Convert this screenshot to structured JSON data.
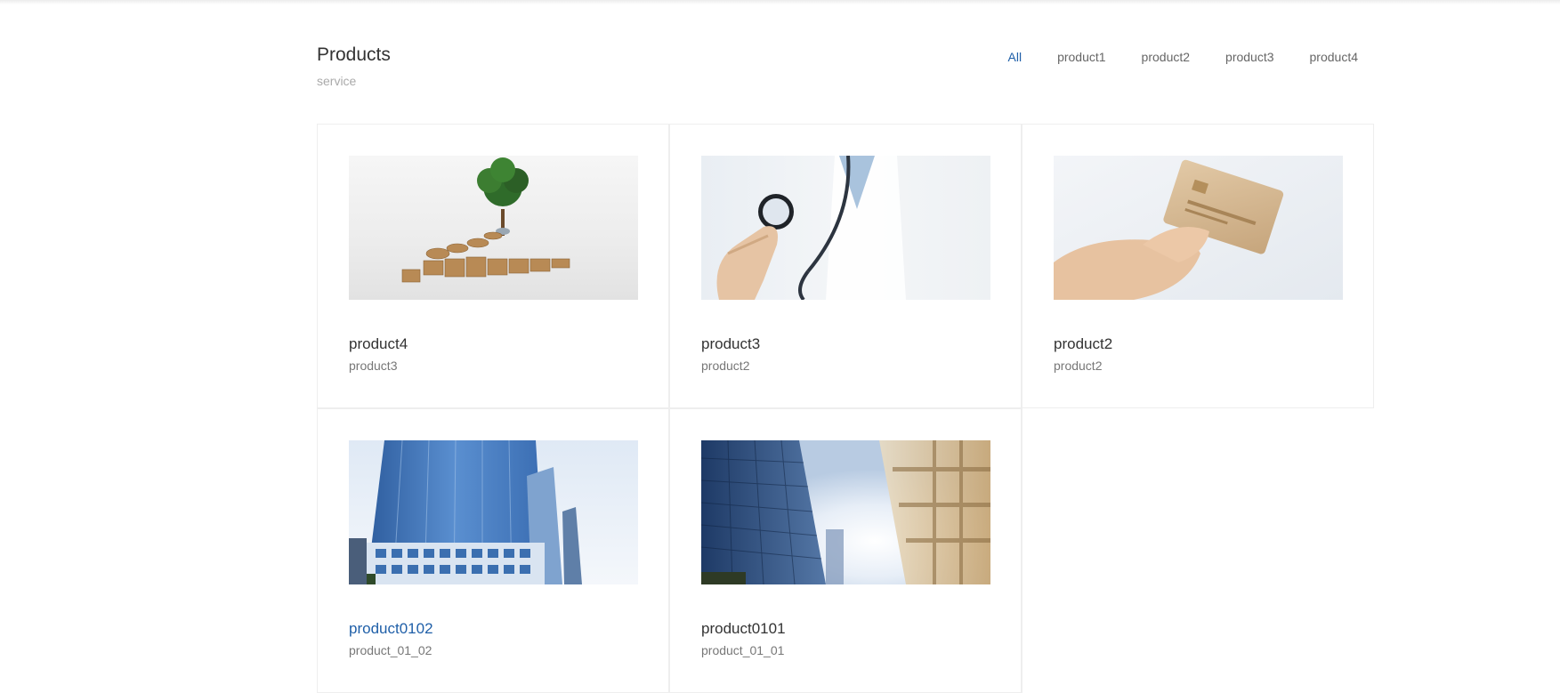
{
  "header": {
    "title": "Products",
    "subtitle": "service"
  },
  "filters": [
    "All",
    "product1",
    "product2",
    "product3",
    "product4"
  ],
  "active_filter": "All",
  "accent_color": "#1f5fa8",
  "products": [
    {
      "title": "product4",
      "subtitle": "product3",
      "image": "coins-and-tree-image"
    },
    {
      "title": "product3",
      "subtitle": "product2",
      "image": "stethoscope-image"
    },
    {
      "title": "product2",
      "subtitle": "product2",
      "image": "credit-card-image"
    },
    {
      "title": "product0102",
      "subtitle": "product_01_02",
      "image": "glass-tower-image"
    },
    {
      "title": "product0101",
      "subtitle": "product_01_01",
      "image": "buildings-sunlight-image"
    }
  ]
}
